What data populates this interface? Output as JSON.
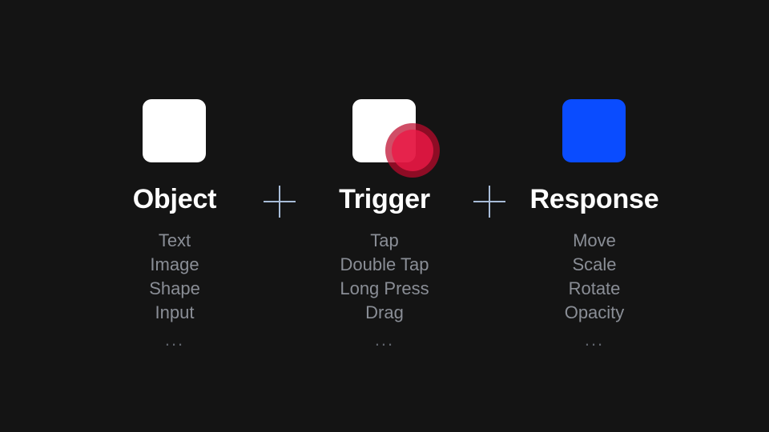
{
  "slide": {
    "background_color": "#141414",
    "operator": "+",
    "columns": [
      {
        "id": "object",
        "heading": "Object",
        "graphic": "white-rounded-square",
        "items": [
          "Text",
          "Image",
          "Shape",
          "Input"
        ],
        "ellipsis": "...",
        "colors": {
          "square": "#ffffff"
        }
      },
      {
        "id": "trigger",
        "heading": "Trigger",
        "graphic": "white-rounded-square-with-tap-indicator",
        "items": [
          "Tap",
          "Double Tap",
          "Long Press",
          "Drag"
        ],
        "ellipsis": "...",
        "colors": {
          "square": "#ffffff",
          "tap_ring": "#be0a2d",
          "tap_dot": "#eb1946"
        }
      },
      {
        "id": "response",
        "heading": "Response",
        "graphic": "blue-rounded-square",
        "items": [
          "Move",
          "Scale",
          "Rotate",
          "Opacity"
        ],
        "ellipsis": "...",
        "colors": {
          "square": "#0a4cff"
        }
      }
    ],
    "text_colors": {
      "heading": "#ffffff",
      "item": "#8a8e96",
      "ellipsis": "#61656d",
      "plus": "#a8bcd8"
    }
  }
}
